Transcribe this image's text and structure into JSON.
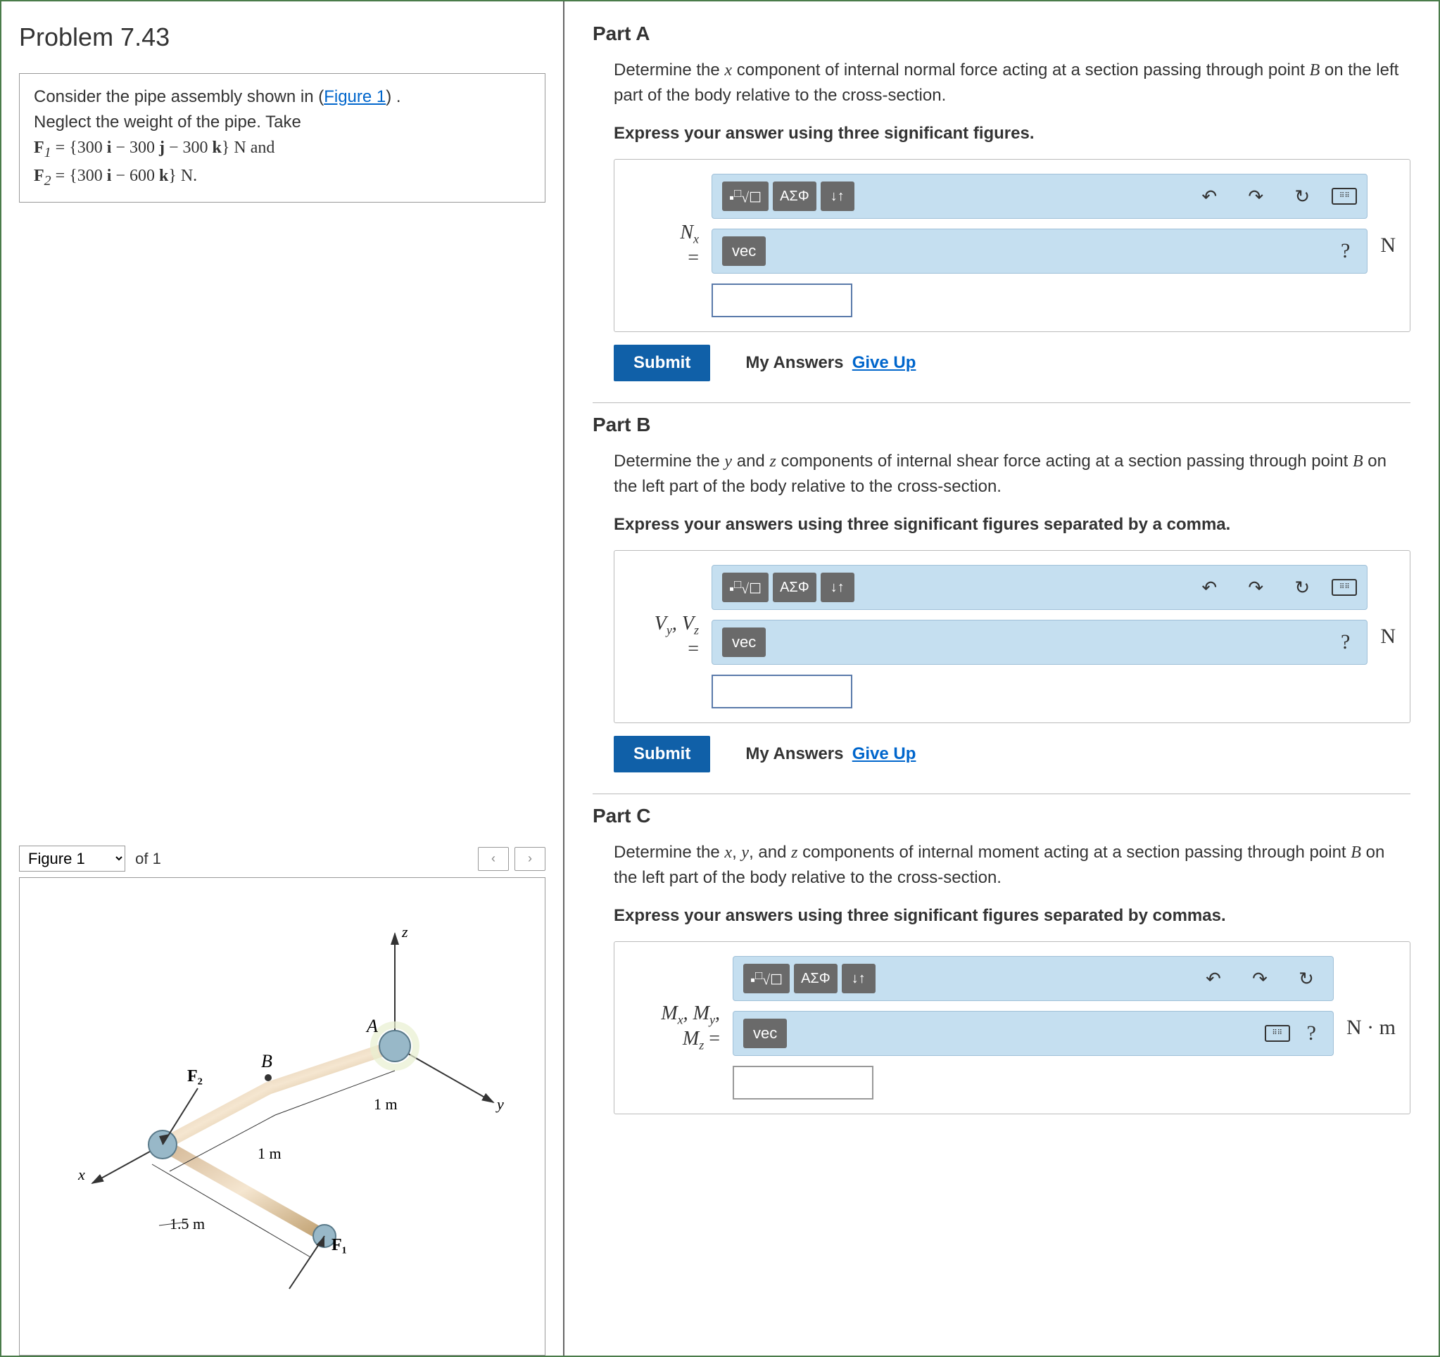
{
  "problem": {
    "title": "Problem 7.43",
    "intro_pre": "Consider the pipe assembly shown in (",
    "figure_link": "Figure 1",
    "intro_post": ") .",
    "line2": "Neglect the weight of the pipe. Take",
    "f1_label": "F",
    "f1_sub": "1",
    "f1_expr": " = {300 i − 300 j − 300 k} N and",
    "f2_label": "F",
    "f2_sub": "2",
    "f2_expr": " = {300 i − 600 k} N."
  },
  "figure": {
    "label": "Figure 1",
    "of_text": "of 1",
    "prev": "‹",
    "next": "›",
    "labels": {
      "F2": "F₂",
      "F1": "F₁",
      "B": "B",
      "A": "A",
      "x": "x",
      "y": "y",
      "z": "z",
      "d_1m_a": "1 m",
      "d_1m_b": "1 m",
      "d_15m": "1.5 m"
    }
  },
  "toolbar": {
    "templates": "▪√☐",
    "greek": "ΑΣΦ",
    "subsup": "↓↑",
    "undo": "↶",
    "redo": "↷",
    "reset": "↻",
    "keyboard": "⌨",
    "vec": "vec",
    "help": "?"
  },
  "partA": {
    "title": "Part A",
    "desc_pre": "Determine the ",
    "var1": "x",
    "desc_mid": " component of internal normal force acting at a section passing through point ",
    "pointB": "B",
    "desc_post": " on the left part of the body relative to the cross-section.",
    "instruct": "Express your answer using three significant figures.",
    "var_html": "N<sub class='sub'>x</sub>",
    "equals": "=",
    "unit": "N",
    "submit": "Submit",
    "my_answers": "My Answers",
    "give_up": "Give Up"
  },
  "partB": {
    "title": "Part B",
    "desc_pre": "Determine the ",
    "var1": "y",
    "and": " and ",
    "var2": "z",
    "desc_mid": " components of internal shear force acting at a section passing through point ",
    "pointB": "B",
    "desc_post": " on the left part of the body relative to the cross-section.",
    "instruct": "Express your answers using three significant figures separated by a comma.",
    "var_line1": "V<sub class='sub'>y</sub>, V<sub class='sub'>z</sub>",
    "equals": "=",
    "unit": "N",
    "submit": "Submit",
    "my_answers": "My Answers",
    "give_up": "Give Up"
  },
  "partC": {
    "title": "Part C",
    "desc_pre": "Determine the ",
    "var1": "x",
    "c1": ", ",
    "var2": "y",
    "c2": ", and ",
    "var3": "z",
    "desc_mid": " components of internal moment acting at a section passing through point ",
    "pointB": "B",
    "desc_post": " on the left part of the body relative to the cross-section.",
    "instruct": "Express your answers using three significant figures separated by commas.",
    "var_line1": "M<sub class='sub'>x</sub>, M<sub class='sub'>y</sub>,",
    "var_line2": "M<sub class='sub'>z</sub> =",
    "unit": "N · m"
  }
}
